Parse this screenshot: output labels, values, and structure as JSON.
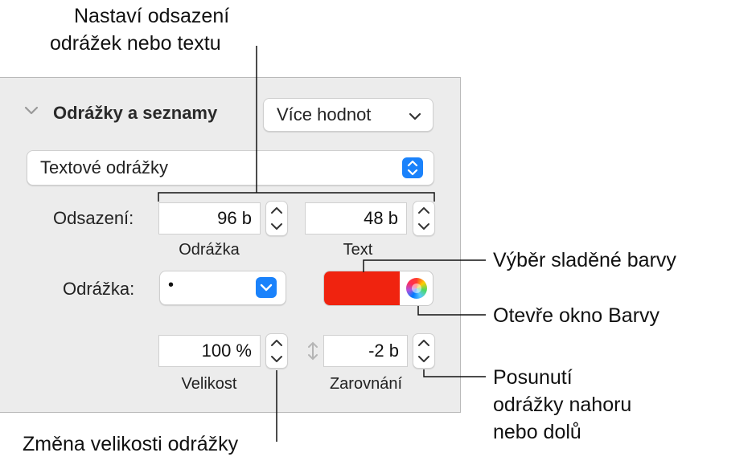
{
  "annotations": {
    "indent_line1": "Nastaví odsazení",
    "indent_line2": "odrážek nebo textu",
    "matching_color": "Výběr sladěné barvy",
    "open_colors": "Otevře okno Barvy",
    "move_line1": "Posunutí",
    "move_line2": "odrážky nahoru",
    "move_line3": "nebo dolů",
    "size_change": "Změna velikosti odrážky"
  },
  "panel": {
    "section_title": "Odrážky a seznamy",
    "values_button": "Více hodnot",
    "bullet_type": "Textové odrážky",
    "indent_label": "Odsazení:",
    "indent_bullet_value": "96 b",
    "indent_text_value": "48 b",
    "indent_bullet_sublabel": "Odrážka",
    "indent_text_sublabel": "Text",
    "bullet_label": "Odrážka:",
    "bullet_value": "•",
    "size_value": "100 %",
    "size_sublabel": "Velikost",
    "align_value": "-2 b",
    "align_sublabel": "Zarovnání"
  },
  "colors": {
    "swatch": "#f0230f",
    "accent": "#1a82fb",
    "panel_bg": "#ececec"
  },
  "icons": [
    "chevron-down-icon",
    "chevron-down-icon",
    "updown-arrows-icon",
    "stepper-icon",
    "color-wheel-icon",
    "vertical-arrows-icon"
  ]
}
